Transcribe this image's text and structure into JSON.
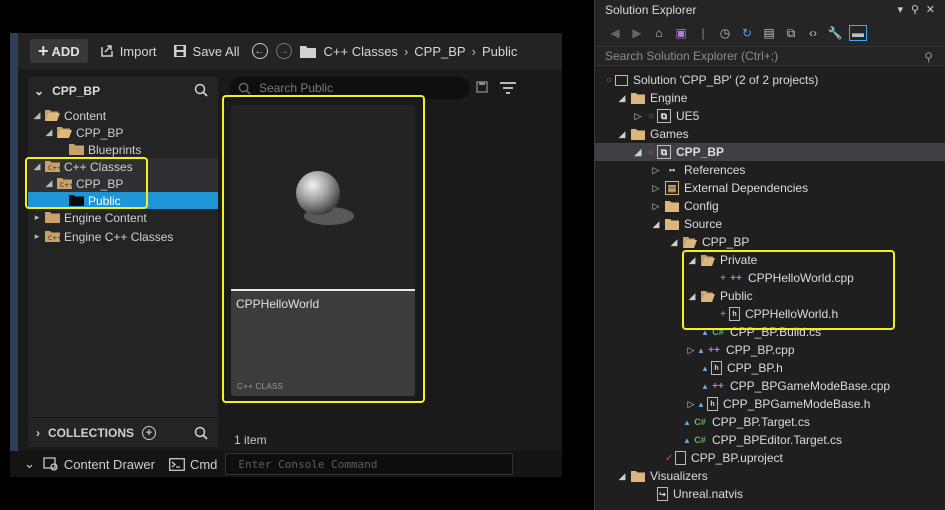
{
  "unreal": {
    "toolbar": {
      "add": "ADD",
      "import": "Import",
      "save_all": "Save All",
      "breadcrumb": [
        "C++ Classes",
        "CPP_BP",
        "Public"
      ]
    },
    "tree": {
      "header": "CPP_BP",
      "items": [
        {
          "label": "Content",
          "depth": 0
        },
        {
          "label": "CPP_BP",
          "depth": 1
        },
        {
          "label": "Blueprints",
          "depth": 2
        },
        {
          "label": "C++ Classes",
          "depth": 0
        },
        {
          "label": "CPP_BP",
          "depth": 1
        },
        {
          "label": "Public",
          "depth": 2
        },
        {
          "label": "Engine Content",
          "depth": 0
        },
        {
          "label": "Engine C++ Classes",
          "depth": 0
        }
      ]
    },
    "collections_label": "COLLECTIONS",
    "search_placeholder": "Search Public",
    "asset": {
      "name": "CPPHelloWorld",
      "type": "C++ CLASS"
    },
    "item_count": "1 item",
    "status": {
      "content_drawer": "Content Drawer",
      "cmd": "Cmd",
      "console_placeholder": "Enter Console Command"
    }
  },
  "solution_explorer": {
    "title": "Solution Explorer",
    "search_placeholder": "Search Solution Explorer (Ctrl+;)",
    "tree": [
      {
        "label": "Solution 'CPP_BP' (2 of 2 projects)"
      },
      {
        "label": "Engine"
      },
      {
        "label": "UE5"
      },
      {
        "label": "Games"
      },
      {
        "label": "CPP_BP"
      },
      {
        "label": "References"
      },
      {
        "label": "External Dependencies"
      },
      {
        "label": "Config"
      },
      {
        "label": "Source"
      },
      {
        "label": "CPP_BP"
      },
      {
        "label": "Private"
      },
      {
        "label": "CPPHelloWorld.cpp"
      },
      {
        "label": "Public"
      },
      {
        "label": "CPPHelloWorld.h"
      },
      {
        "label": "CPP_BP.Build.cs"
      },
      {
        "label": "CPP_BP.cpp"
      },
      {
        "label": "CPP_BP.h"
      },
      {
        "label": "CPP_BPGameModeBase.cpp"
      },
      {
        "label": "CPP_BPGameModeBase.h"
      },
      {
        "label": "CPP_BP.Target.cs"
      },
      {
        "label": "CPP_BPEditor.Target.cs"
      },
      {
        "label": "CPP_BP.uproject"
      },
      {
        "label": "Visualizers"
      },
      {
        "label": "Unreal.natvis"
      }
    ]
  }
}
